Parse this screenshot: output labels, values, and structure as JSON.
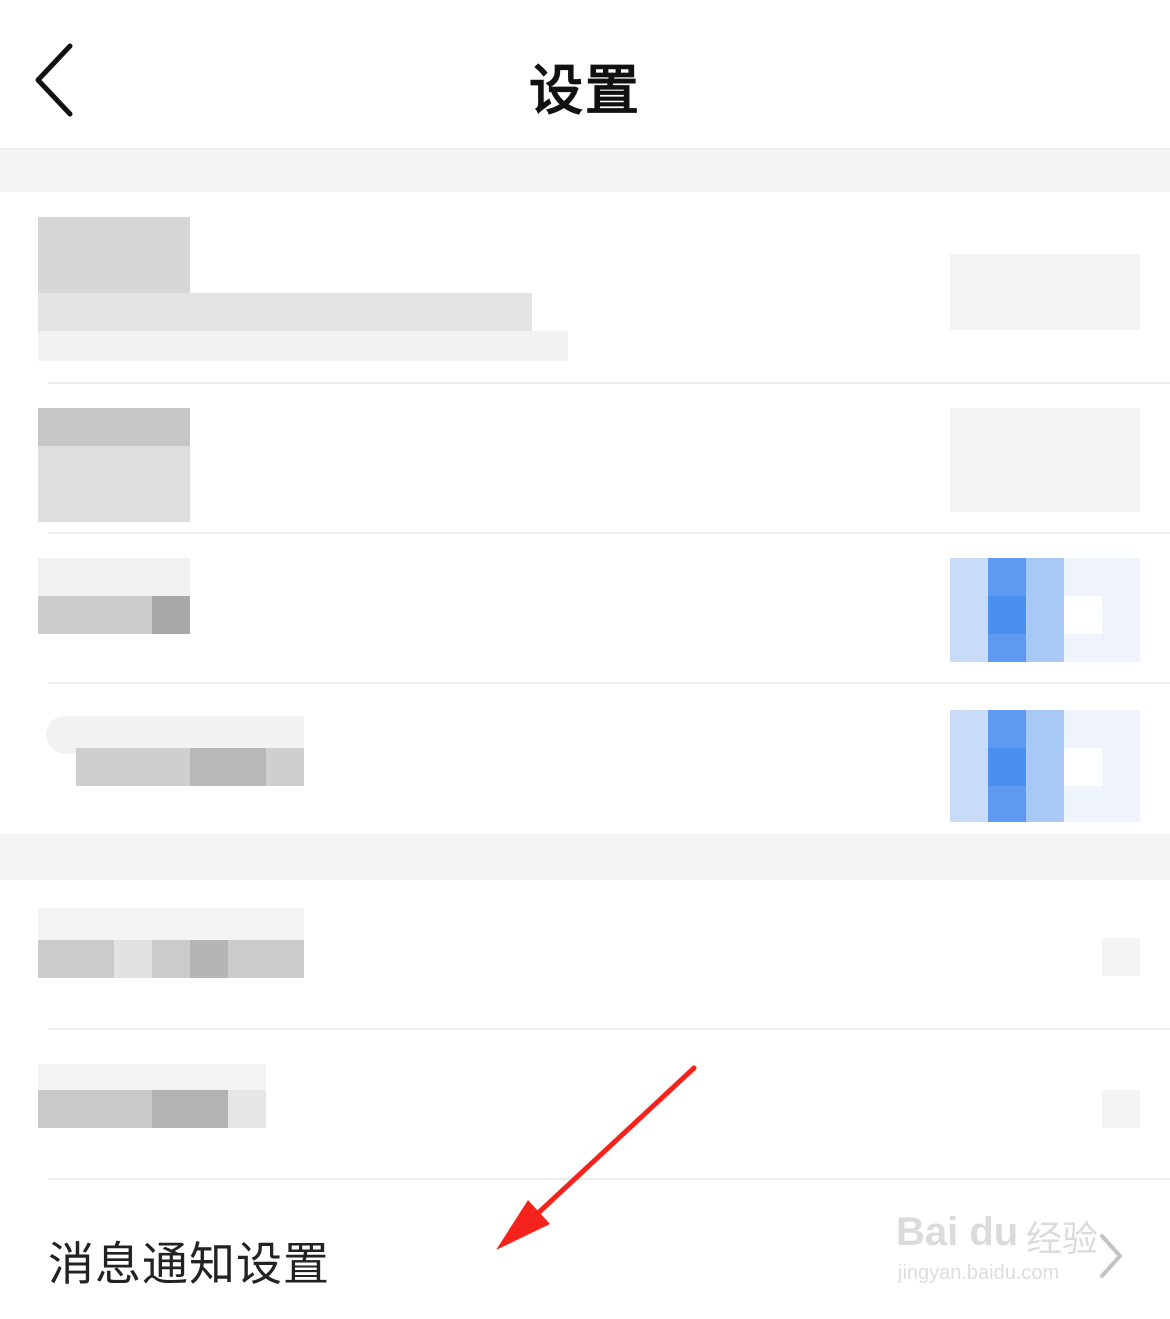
{
  "header": {
    "title": "设置",
    "back_icon": "chevron-left-icon"
  },
  "rows": {
    "notification_settings": {
      "label": "消息通知设置",
      "chevron_icon": "chevron-right-icon"
    }
  },
  "watermark": {
    "brand": "Bai du",
    "brand_cn": "经验",
    "url": "jingyan.baidu.com"
  },
  "colors": {
    "background": "#ffffff",
    "section_gap": "#f5f5f5",
    "divider": "#ececec",
    "annotation_arrow": "#f5231b",
    "toggle_blue": "#4a8ff0"
  }
}
